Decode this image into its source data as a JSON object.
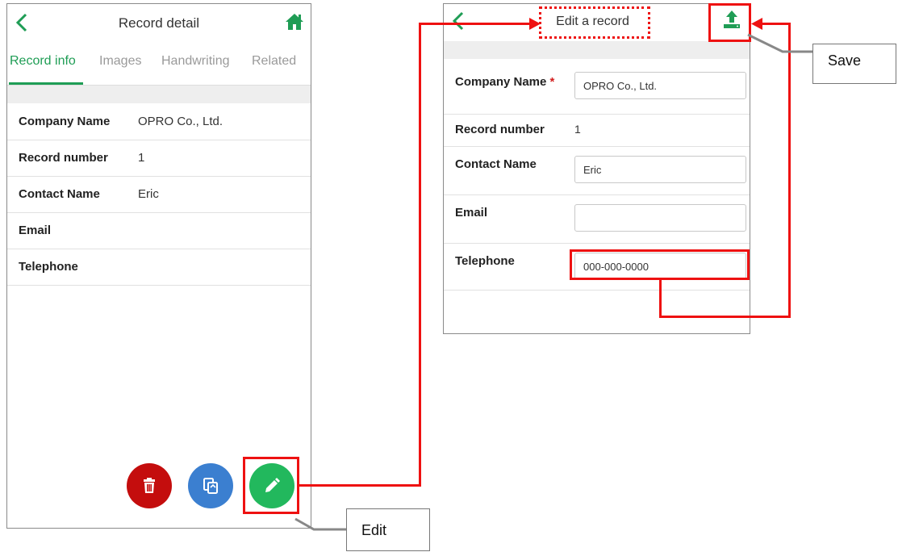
{
  "detail_screen": {
    "title": "Record detail",
    "tabs": [
      "Record info",
      "Images",
      "Handwriting",
      "Related"
    ],
    "fields": [
      {
        "label": "Company Name",
        "value": "OPRO Co., Ltd."
      },
      {
        "label": "Record number",
        "value": "1"
      },
      {
        "label": "Contact Name",
        "value": "Eric"
      },
      {
        "label": "Email",
        "value": ""
      },
      {
        "label": "Telephone",
        "value": ""
      }
    ],
    "actions": [
      "delete-icon",
      "copy-icon",
      "edit-icon"
    ]
  },
  "edit_screen": {
    "title": "Edit a record",
    "required_marker": "*",
    "fields": [
      {
        "label": "Company Name",
        "value": "OPRO Co., Ltd."
      },
      {
        "label": "Record number",
        "value": "1"
      },
      {
        "label": "Contact Name",
        "value": "Eric"
      },
      {
        "label": "Email",
        "value": ""
      },
      {
        "label": "Telephone",
        "value": "000-000-0000"
      }
    ]
  },
  "callouts": {
    "save": "Save",
    "edit": "Edit"
  },
  "colors": {
    "accent_green": "#1f9d55",
    "highlight_red": "#e11111",
    "delete_red": "#c40d0d",
    "copy_blue": "#3b7fd0",
    "edit_green": "#22b85d"
  }
}
